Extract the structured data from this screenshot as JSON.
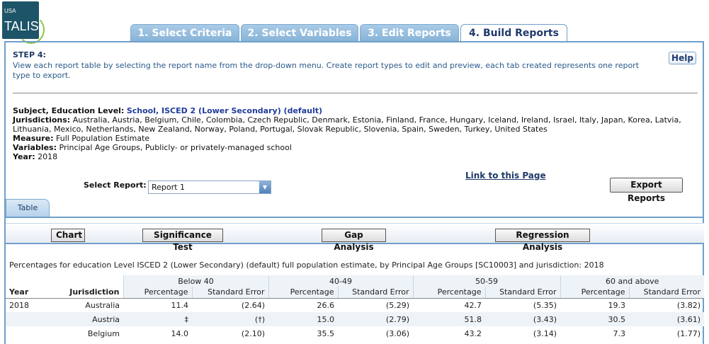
{
  "logo": {
    "top_text": "USA",
    "main_text": "TALIS"
  },
  "tabs": [
    {
      "label": "1. Select Criteria"
    },
    {
      "label": "2. Select Variables"
    },
    {
      "label": "3. Edit Reports"
    },
    {
      "label": "4. Build Reports"
    }
  ],
  "step": {
    "title": "STEP 4:",
    "description": "View each report table by selecting the report name from the drop-down menu. Create report types to edit and preview, each tab created represents one report type to export.",
    "help_label": "Help"
  },
  "selection": {
    "subject_label": "Subject, Education Level:",
    "subject_value": "School, ISCED 2 (Lower Secondary) (default)",
    "jurisdictions_label": "Jurisdictions:",
    "jurisdictions_value": "Australia, Austria, Belgium, Chile, Colombia, Czech Republic, Denmark, Estonia, Finland, France, Hungary, Iceland, Ireland, Israel, Italy, Japan, Korea, Latvia, Lithuania, Mexico, Netherlands, New Zealand, Norway, Poland, Portugal, Slovak Republic, Slovenia, Spain, Sweden, Turkey, United States",
    "measure_label": "Measure:",
    "measure_value": "Full Population Estimate",
    "variables_label": "Variables:",
    "variables_value": "Principal Age Groups, Publicly- or privately-managed school",
    "year_label": "Year:",
    "year_value": "2018"
  },
  "report": {
    "select_label": "Select Report:",
    "selected": "Report 1",
    "link_label": "Link to this Page",
    "export_label": "Export Reports",
    "table_tab": "Table"
  },
  "buttons": {
    "chart": "Chart",
    "significance": "Significance Test",
    "gap": "Gap Analysis",
    "regression": "Regression Analysis"
  },
  "table": {
    "caption": "Percentages for education Level ISCED 2 (Lower Secondary) (default) full population estimate, by Principal Age Groups [SC10003] and jurisdiction: 2018",
    "year_header": "Year",
    "jurisdiction_header": "Jurisdiction",
    "groups": [
      "Below 40",
      "40-49",
      "50-59",
      "60 and above"
    ],
    "sub_pct": "Percentage",
    "sub_se": "Standard Error",
    "rows": [
      {
        "year": "2018",
        "jurisdiction": "Australia",
        "cells": [
          "11.4",
          "(2.64)",
          "26.6",
          "(5.29)",
          "42.7",
          "(5.35)",
          "19.3",
          "(3.82)"
        ]
      },
      {
        "year": "",
        "jurisdiction": "Austria",
        "cells": [
          "‡",
          "(†)",
          "15.0",
          "(2.79)",
          "51.8",
          "(3.43)",
          "30.5",
          "(3.61)"
        ]
      },
      {
        "year": "",
        "jurisdiction": "Belgium",
        "cells": [
          "14.0",
          "(2.10)",
          "35.5",
          "(3.06)",
          "43.2",
          "(3.14)",
          "7.3",
          "(1.77)"
        ]
      }
    ]
  }
}
